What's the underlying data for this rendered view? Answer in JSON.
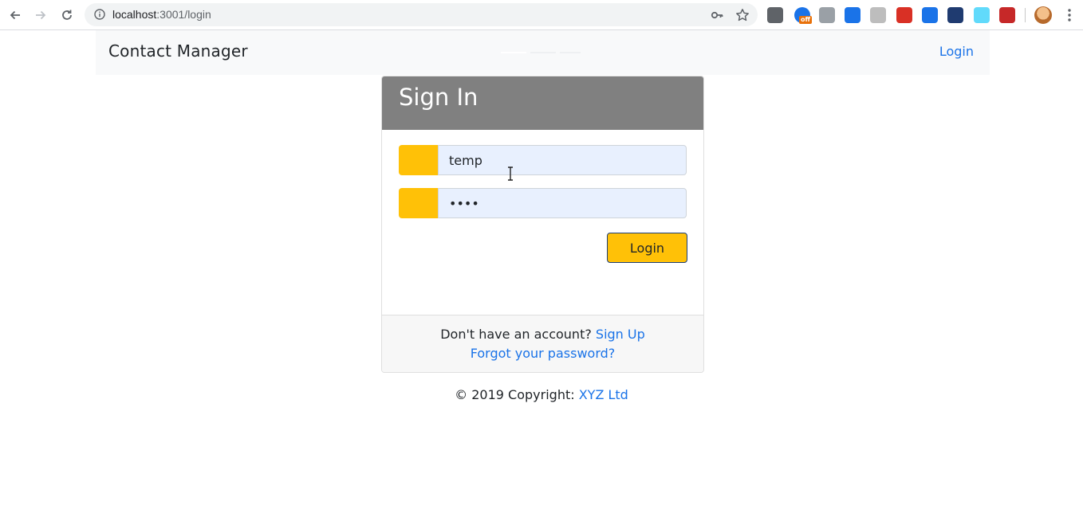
{
  "browser": {
    "url_host": "localhost",
    "url_rest": ":3001/login",
    "extensions": [
      {
        "name": "settings-extension-icon",
        "color": "#5f6368"
      },
      {
        "name": "edge-off-extension-icon",
        "color": "#1a73e8",
        "badge": "off"
      },
      {
        "name": "power-extension-icon",
        "color": "#9aa0a6"
      },
      {
        "name": "window-extension-icon",
        "color": "#1a73e8"
      },
      {
        "name": "puzzle-extension-icon",
        "color": "#bdbdbd"
      },
      {
        "name": "shield-extension-icon",
        "color": "#d93025"
      },
      {
        "name": "cube-extension-icon",
        "color": "#1a73e8"
      },
      {
        "name": "monitor-extension-icon",
        "color": "#1f3b70"
      },
      {
        "name": "react-extension-icon",
        "color": "#61dafb"
      },
      {
        "name": "red-tool-extension-icon",
        "color": "#c62828"
      }
    ]
  },
  "navbar": {
    "brand": "Contact Manager",
    "login_link": "Login"
  },
  "card": {
    "title": "Sign In",
    "username_value": "temp",
    "password_value": "temp",
    "login_button": "Login",
    "footer_prompt": "Don't have an account? ",
    "signup_link": "Sign Up",
    "forgot_link": "Forgot your password?"
  },
  "footer": {
    "copyright_prefix": "© 2019 Copyright: ",
    "company_link": "XYZ Ltd"
  },
  "colors": {
    "accent": "#ffc107",
    "header_gray": "#808080",
    "link_blue": "#1a73e8"
  }
}
